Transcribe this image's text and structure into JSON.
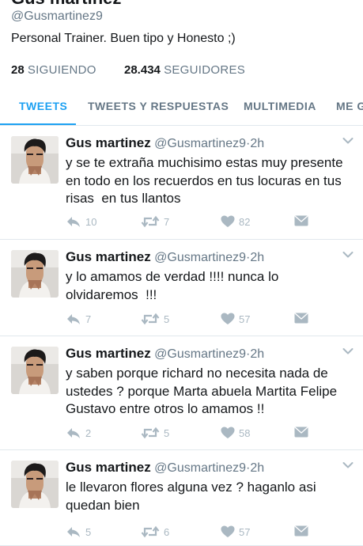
{
  "profile": {
    "name": "Gus martinez",
    "handle": "@Gusmartinez9",
    "bio": "Personal Trainer. Buen tipo y Honesto ;)",
    "following_count": "28",
    "following_label": "SIGUIENDO",
    "followers_count": "28.434",
    "followers_label": "SEGUIDORES"
  },
  "tabs": [
    {
      "label": "TWEETS",
      "active": true
    },
    {
      "label": "TWEETS Y RESPUESTAS",
      "active": false
    },
    {
      "label": "MULTIMEDIA",
      "active": false
    },
    {
      "label": "ME G",
      "active": false
    }
  ],
  "tweets": [
    {
      "author": "Gus martinez",
      "handle": "@Gusmartinez9",
      "sep": "·",
      "time": "2h",
      "text": "y se te extraña muchisimo estas muy presente en todo en los recuerdos en tus locuras en tus risas  en tus llantos",
      "replies": "10",
      "retweets": "7",
      "likes": "82"
    },
    {
      "author": "Gus martinez",
      "handle": "@Gusmartinez9",
      "sep": "·",
      "time": "2h",
      "text": "y lo amamos de verdad !!!! nunca lo olvidaremos  !!!",
      "replies": "7",
      "retweets": "5",
      "likes": "57"
    },
    {
      "author": "Gus martinez",
      "handle": "@Gusmartinez9",
      "sep": "·",
      "time": "2h",
      "text": "y saben porque richard no necesita nada de ustedes ? porque Marta abuela Martita Felipe Gustavo entre otros lo amamos !!",
      "replies": "2",
      "retweets": "5",
      "likes": "58"
    },
    {
      "author": "Gus martinez",
      "handle": "@Gusmartinez9",
      "sep": "·",
      "time": "2h",
      "text": "le llevaron flores alguna vez ? haganlo asi quedan bien",
      "replies": "5",
      "retweets": "6",
      "likes": "57"
    }
  ],
  "icons": {
    "reply": "reply-icon",
    "retweet": "retweet-icon",
    "like": "heart-icon",
    "dm": "envelope-icon",
    "caret": "chevron-down-icon"
  },
  "colors": {
    "accent": "#1da1f2",
    "secondary_text": "#657786",
    "action_icon": "#aab8c2",
    "divider": "#e1e8ed"
  }
}
